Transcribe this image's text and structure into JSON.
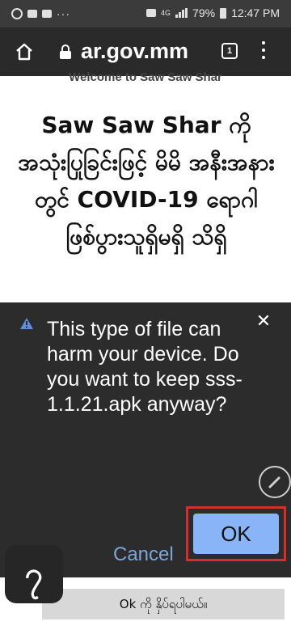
{
  "status_bar": {
    "battery": "79%",
    "time": "12:47 PM",
    "network": "4G"
  },
  "browser": {
    "url": "ar.gov.mm",
    "tab_count": "1"
  },
  "page": {
    "welcome": "Welcome to Saw Saw Shar",
    "headline": "Saw Saw Shar ကို အသုံးပြုခြင်းဖြင့် မိမိ အနီးအနားတွင် COVID-19 ရောဂါ ဖြစ်ပွားသူရှိမရှိ သိရှိ"
  },
  "dialog": {
    "message": "This type of file can harm your device. Do you want to keep sss-1.1.21.apk anyway?",
    "cancel_label": "Cancel",
    "ok_label": "OK"
  },
  "caption": {
    "step": "၇",
    "text": "Ok ကို နှိပ်ရပါမယ်။"
  },
  "colors": {
    "ok_button": "#8ab4f8",
    "highlight_border": "#d32f2f",
    "cancel_text": "#7ea5d8"
  }
}
